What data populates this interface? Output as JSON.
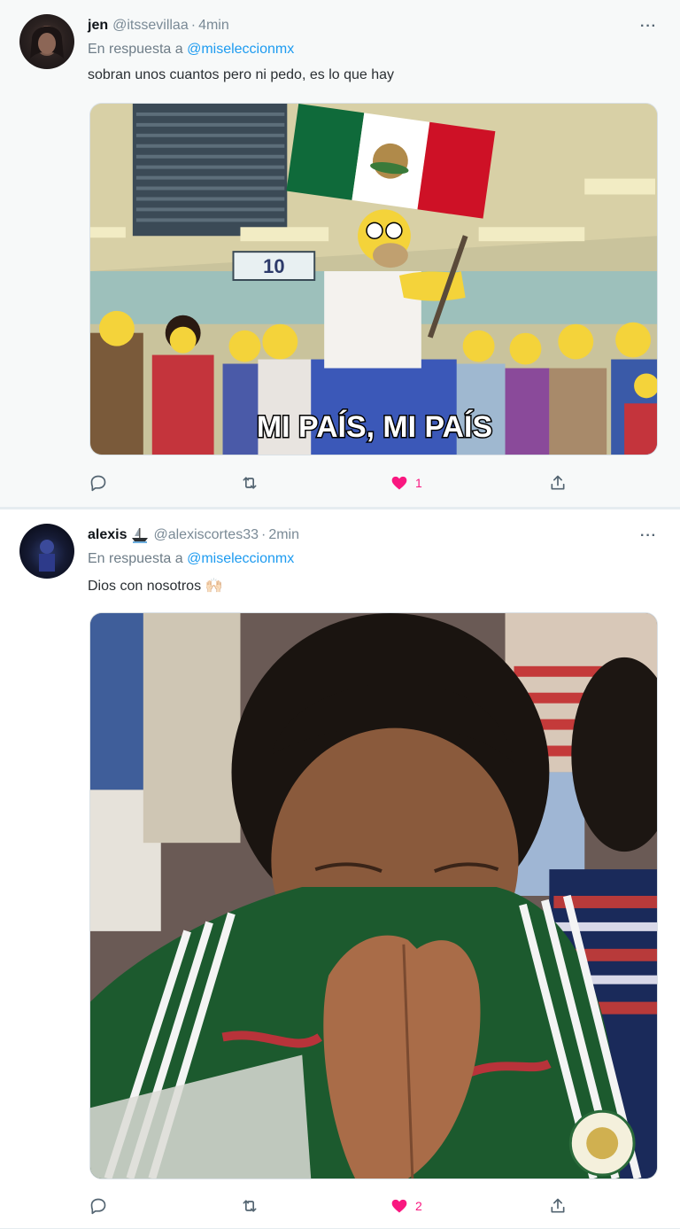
{
  "tweets": [
    {
      "name": "jen",
      "handle": "@itssevillaa",
      "separator": "·",
      "time": "4min",
      "more_label": "···",
      "reply_prefix": "En respuesta a",
      "reply_mention": "@miseleccionmx",
      "text": "sobran unos cuantos pero ni pedo, es lo que hay",
      "media": {
        "type": "cartoon-meme",
        "caption": "MI PAÍS, MI PAÍS",
        "sign_number": "10"
      },
      "actions": {
        "reply_icon": "reply-icon",
        "retweet_icon": "retweet-icon",
        "like_icon": "heart-filled-icon",
        "like_count": "1",
        "share_icon": "share-icon"
      }
    },
    {
      "name": "alexis",
      "name_badge_icon": "ship-emoji-icon",
      "handle": "@alexiscortes33",
      "separator": "·",
      "time": "2min",
      "more_label": "···",
      "reply_prefix": "En respuesta a",
      "reply_mention": "@miseleccionmx",
      "text": "Dios con nosotros 🙌🏻",
      "media": {
        "type": "photo-praying-child"
      },
      "actions": {
        "reply_icon": "reply-icon",
        "retweet_icon": "retweet-icon",
        "like_icon": "heart-filled-icon",
        "like_count": "2",
        "share_icon": "share-icon"
      }
    }
  ],
  "colors": {
    "mention": "#1d9bf0",
    "like": "#f91880",
    "muted": "#7a8a96"
  }
}
